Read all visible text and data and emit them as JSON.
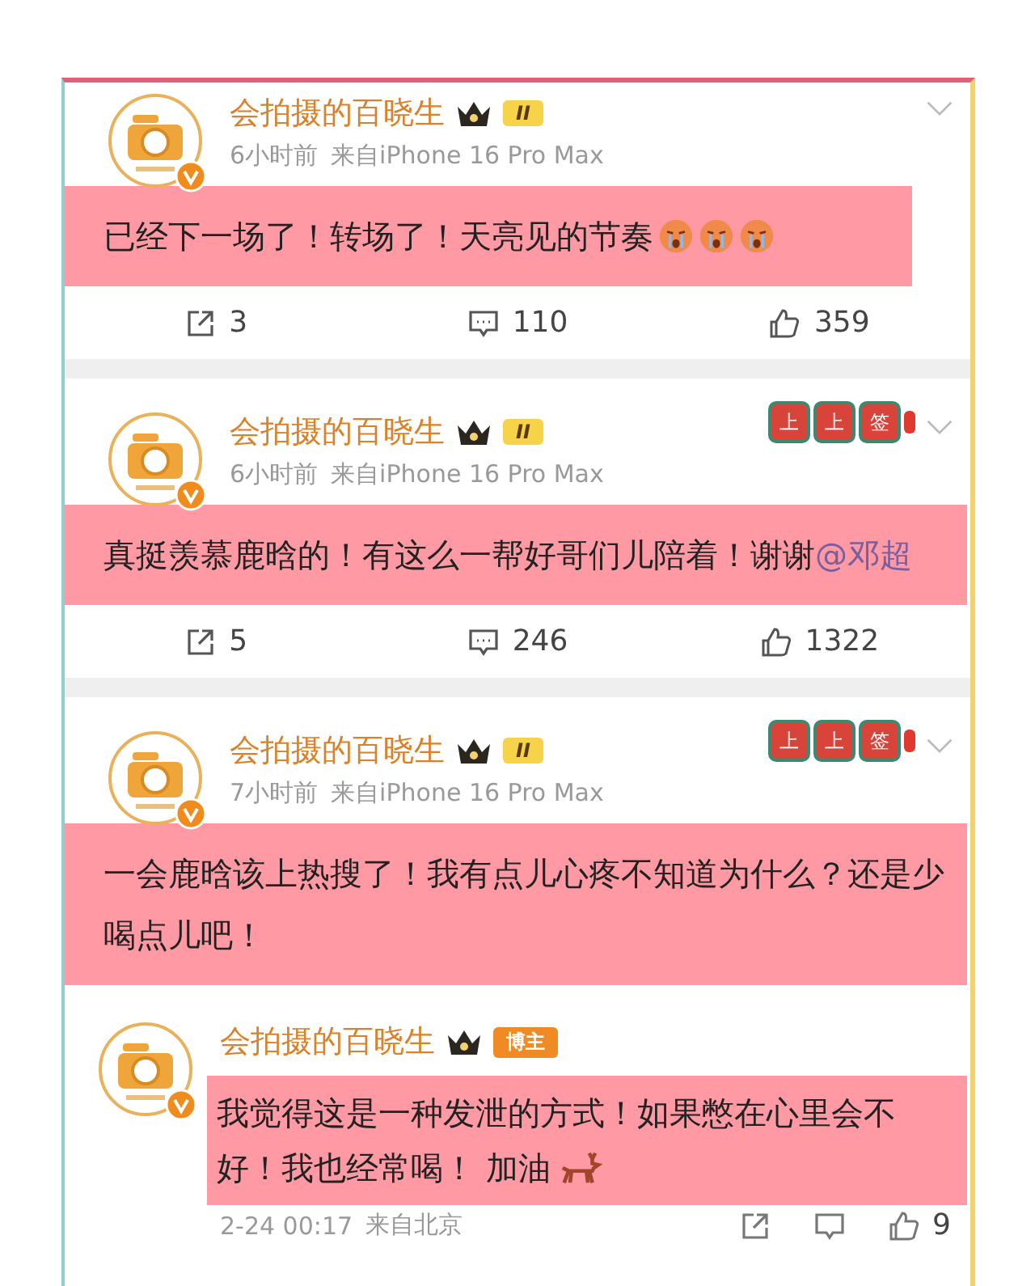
{
  "posts": [
    {
      "kind": "post",
      "author": "会拍摄的百晓生",
      "badge": "II",
      "time": "6小时前",
      "source": "来自iPhone 16 Pro Max",
      "highlighted": true,
      "text": "已经下一场了！转场了！天亮见的节奏",
      "emojis": [
        {
          "kind": "crying"
        },
        {
          "kind": "crying"
        },
        {
          "kind": "crying"
        }
      ],
      "reposts": "3",
      "comments": "110",
      "likes": "359"
    },
    {
      "kind": "post",
      "author": "会拍摄的百晓生",
      "badge": "II",
      "time": "6小时前",
      "source": "来自iPhone 16 Pro Max",
      "banner": [
        "上",
        "上",
        "签"
      ],
      "highlighted": true,
      "text": "真挺羡慕鹿晗的！有这么一帮好哥们儿陪着！谢谢",
      "mention": "@邓超",
      "reposts": "5",
      "comments": "246",
      "likes": "1322"
    },
    {
      "kind": "post",
      "author": "会拍摄的百晓生",
      "badge": "II",
      "time": "7小时前",
      "source": "来自iPhone 16 Pro Max",
      "banner": [
        "上",
        "上",
        "签"
      ],
      "highlighted": true,
      "text": "一会鹿晗该上热搜了！我有点儿心疼不知道为什么？还是少喝点儿吧！"
    },
    {
      "kind": "comment",
      "author": "会拍摄的百晓生",
      "badge": "博主",
      "highlighted": true,
      "text": "我觉得这是一种发泄的方式！如果憋在心里会不好！我也经常喝！ 加油",
      "emojis": [
        {
          "kind": "deer"
        }
      ],
      "time": "2-24 00:17",
      "source": "来自北京",
      "likes": "9"
    }
  ]
}
